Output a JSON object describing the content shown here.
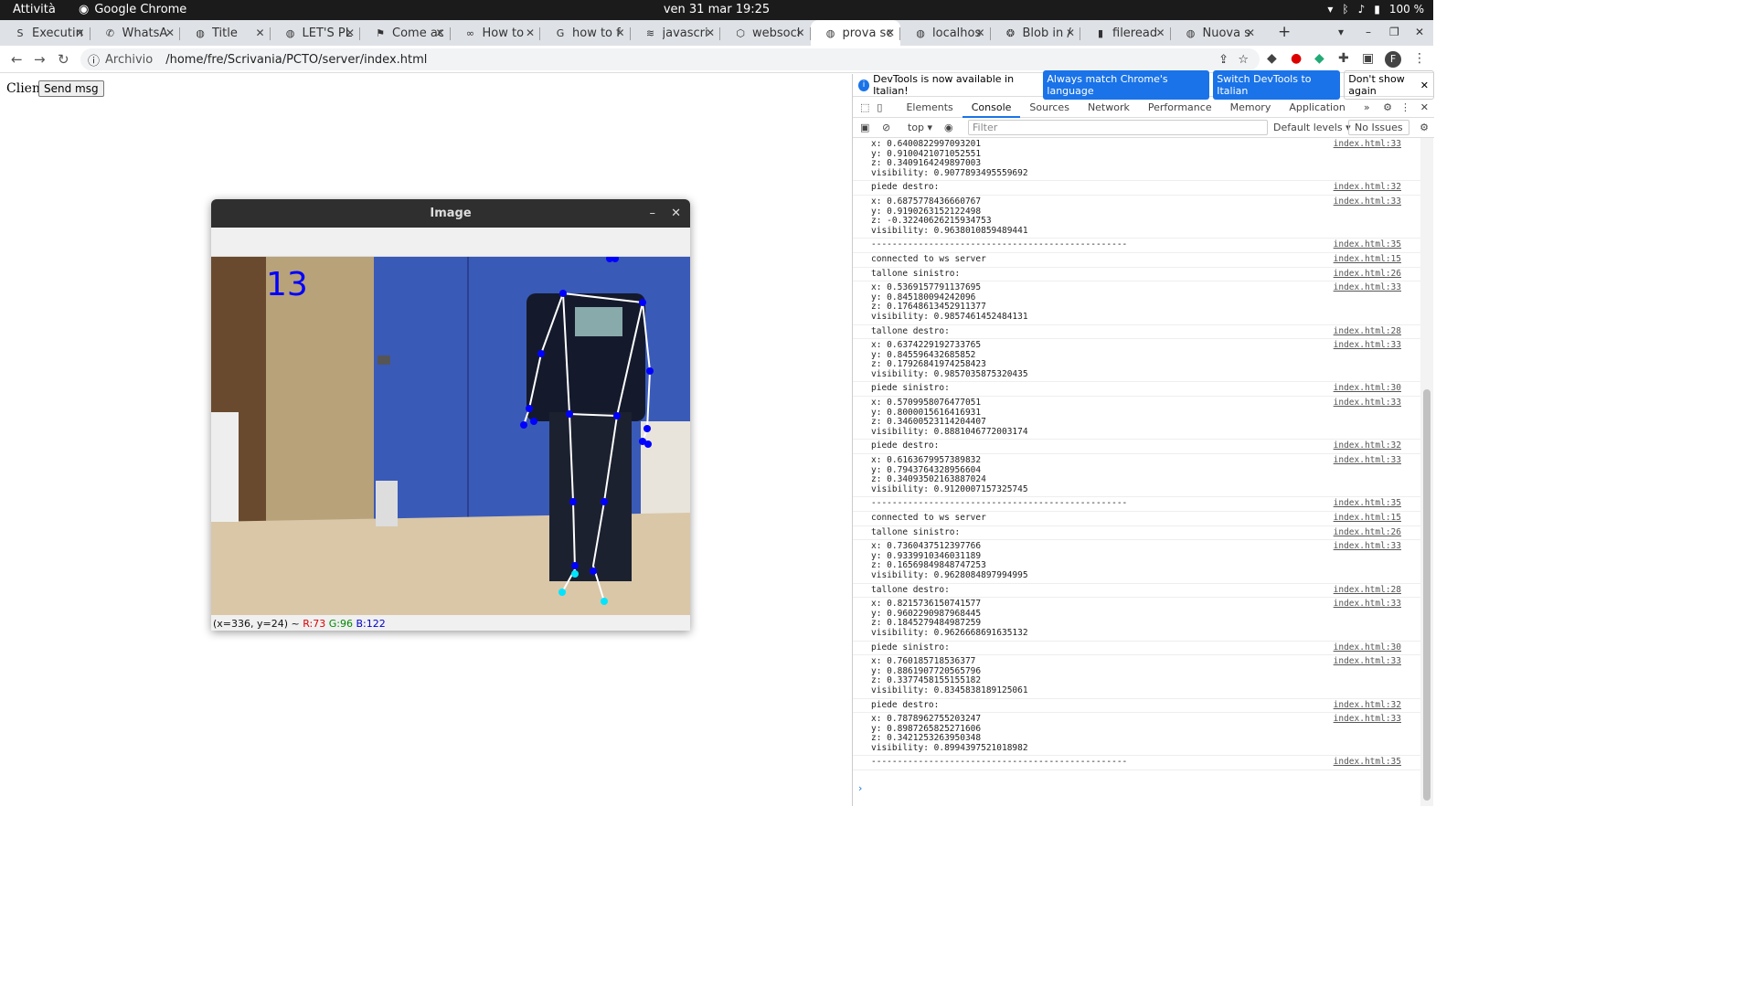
{
  "system_bar": {
    "activities": "Attività",
    "app": "Google Chrome",
    "clock": "ven 31 mar  19:25",
    "battery": "100 %"
  },
  "tabs": [
    {
      "title": "Executin",
      "icon": "SA"
    },
    {
      "title": "WhatsA",
      "icon": "whatsapp-icon"
    },
    {
      "title": "Title",
      "icon": "globe-icon"
    },
    {
      "title": "LET'S PL",
      "icon": "globe-icon"
    },
    {
      "title": "Come ac",
      "icon": "bookmark-icon"
    },
    {
      "title": "How to",
      "icon": "link-icon"
    },
    {
      "title": "how to f",
      "icon": "google-icon"
    },
    {
      "title": "javascri",
      "icon": "stack-icon"
    },
    {
      "title": "websocl",
      "icon": "hex-icon"
    },
    {
      "title": "prova sc",
      "icon": "globe-icon",
      "active": true
    },
    {
      "title": "localhos",
      "icon": "globe-icon"
    },
    {
      "title": "Blob in /",
      "icon": "gpt-icon"
    },
    {
      "title": "fileread",
      "icon": "book-icon"
    },
    {
      "title": "Nuova s",
      "icon": "globe-icon"
    }
  ],
  "address": {
    "label": "Archivio",
    "url": "/home/fre/Scrivania/PCTO/server/index.html"
  },
  "page": {
    "client_label": "Client",
    "send_button": "Send msg"
  },
  "image_window": {
    "title": "Image",
    "overlay_number": "13",
    "status_coords": "(x=336, y=24) ~ ",
    "status_r": "R:73",
    "status_g": "G:96",
    "status_b": "B:122"
  },
  "devtools": {
    "info": "DevTools is now available in Italian!",
    "match_btn": "Always match Chrome's language",
    "switch_btn": "Switch DevTools to Italian",
    "dismiss_btn": "Don't show again",
    "tabs": [
      "Elements",
      "Console",
      "Sources",
      "Network",
      "Performance",
      "Memory",
      "Application"
    ],
    "context": "top",
    "filter_placeholder": "Filter",
    "levels": "Default levels",
    "issues": "No Issues",
    "messages": [
      {
        "text": "x: 0.6400822997093201\ny: 0.9100421071052551\nz: 0.3409164249897003\nvisibility: 0.9077893495559692",
        "src": "index.html:33"
      },
      {
        "text": "piede destro:",
        "src": "index.html:32"
      },
      {
        "text": "x: 0.6875778436660767\ny: 0.9190263152122498\nz: -0.32240626215934753\nvisibility: 0.9638010859489441",
        "src": "index.html:33"
      },
      {
        "text": "-------------------------------------------------",
        "src": "index.html:35"
      },
      {
        "text": "connected to ws server",
        "src": "index.html:15"
      },
      {
        "text": "tallone sinistro:",
        "src": "index.html:26"
      },
      {
        "text": "x: 0.5369157791137695\ny: 0.845180094242096\nz: 0.17648613452911377\nvisibility: 0.9857461452484131",
        "src": "index.html:33"
      },
      {
        "text": "tallone destro:",
        "src": "index.html:28"
      },
      {
        "text": "x: 0.6374229192733765\ny: 0.845596432685852\nz: 0.17926841974258423\nvisibility: 0.9857035875320435",
        "src": "index.html:33"
      },
      {
        "text": "piede sinistro:",
        "src": "index.html:30"
      },
      {
        "text": "x: 0.5709958076477051\ny: 0.8000015616416931\nz: 0.34600523114204407\nvisibility: 0.8881046772003174",
        "src": "index.html:33"
      },
      {
        "text": "piede destro:",
        "src": "index.html:32"
      },
      {
        "text": "x: 0.6163679957389832\ny: 0.7943764328956604\nz: 0.34093502163887024\nvisibility: 0.9120007157325745",
        "src": "index.html:33"
      },
      {
        "text": "-------------------------------------------------",
        "src": "index.html:35"
      },
      {
        "text": "connected to ws server",
        "src": "index.html:15"
      },
      {
        "text": "tallone sinistro:",
        "src": "index.html:26"
      },
      {
        "text": "x: 0.7360437512397766\ny: 0.9339910346031189\nz: 0.16569849848747253\nvisibility: 0.9628084897994995",
        "src": "index.html:33"
      },
      {
        "text": "tallone destro:",
        "src": "index.html:28"
      },
      {
        "text": "x: 0.8215736150741577\ny: 0.9602290987968445\nz: 0.1845279484987259\nvisibility: 0.9626668691635132",
        "src": "index.html:33"
      },
      {
        "text": "piede sinistro:",
        "src": "index.html:30"
      },
      {
        "text": "x: 0.760185718536377\ny: 0.8861907720565796\nz: 0.3377458155155182\nvisibility: 0.8345838189125061",
        "src": "index.html:33"
      },
      {
        "text": "piede destro:",
        "src": "index.html:32"
      },
      {
        "text": "x: 0.7878962755203247\ny: 0.8987265825271606\nz: 0.3421253263950348\nvisibility: 0.8994397521018982",
        "src": "index.html:33"
      },
      {
        "text": "-------------------------------------------------",
        "src": "index.html:35"
      }
    ]
  }
}
